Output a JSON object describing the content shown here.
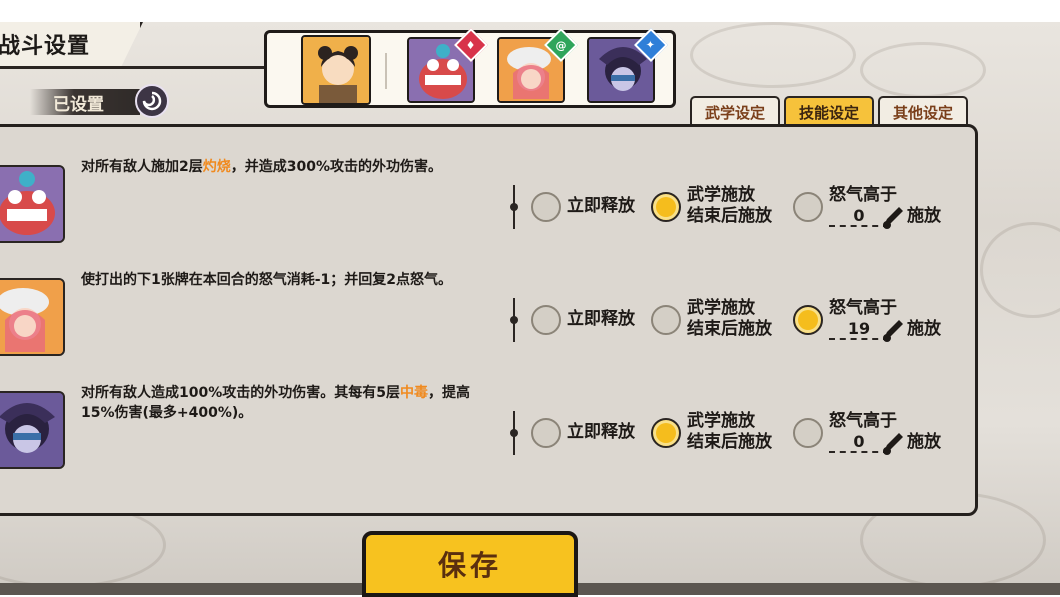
{
  "header": {
    "title": "战斗设置"
  },
  "status": {
    "label": "已设置"
  },
  "team": {
    "leader": "leader-portrait",
    "members": [
      {
        "badge_icon": "shield-icon",
        "badge_color": "#d8334a"
      },
      {
        "badge_icon": "swirl-icon",
        "badge_color": "#2fa55b"
      },
      {
        "badge_icon": "sword-icon",
        "badge_color": "#2f7fd8"
      }
    ]
  },
  "tabs": [
    {
      "label": "武学设定",
      "active": false
    },
    {
      "label": "技能设定",
      "active": true
    },
    {
      "label": "其他设定",
      "active": false
    }
  ],
  "options": {
    "immediate": "立即释放",
    "after_line1": "武学施放",
    "after_line2": "结束后施放",
    "rage_prefix": "怒气高于",
    "rage_suffix": "施放"
  },
  "skills": [
    {
      "desc_a": "对所有敌人施加2层",
      "desc_hl": "灼烧",
      "desc_b": "，并造成300%攻击的外功伤害。",
      "selected": "after",
      "rage_value": "0"
    },
    {
      "desc_a": "使打出的下1张牌在本回合的怒气消耗-1；并回复2点怒气。",
      "desc_hl": "",
      "desc_b": "",
      "selected": "rage",
      "rage_value": "19"
    },
    {
      "desc_a": "对所有敌人造成100%攻击的外功伤害。其每有5层",
      "desc_hl": "中毒",
      "desc_b": "，提高15%伤害(最多+400%)。",
      "selected": "after",
      "rage_value": "0"
    }
  ],
  "footer": {
    "save_label": "保存"
  },
  "colors": {
    "accent": "#f6c23b",
    "highlight": "#f08a1f",
    "ink": "#24201d"
  }
}
